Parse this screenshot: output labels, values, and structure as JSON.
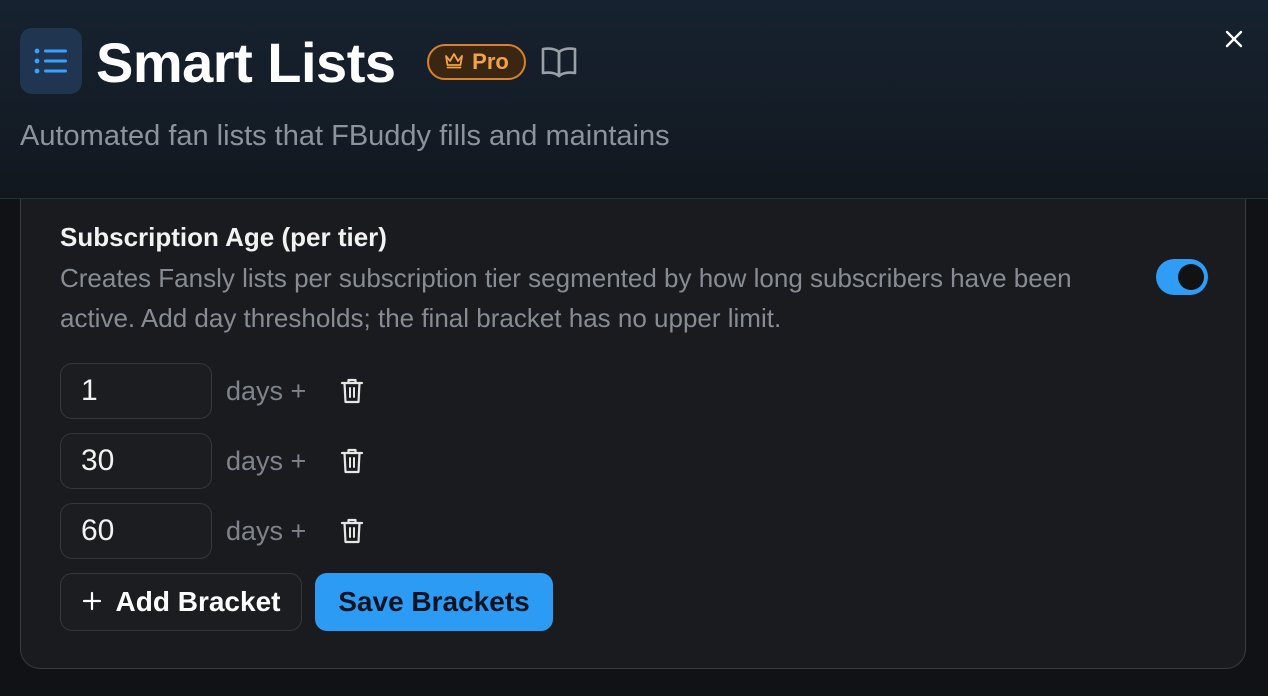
{
  "header": {
    "title": "Smart Lists",
    "badge": "Pro",
    "subtitle": "Automated fan lists that FBuddy fills and maintains",
    "icons": [
      "list-icon",
      "crown-icon",
      "book-icon",
      "close-icon"
    ]
  },
  "setting": {
    "title": "Subscription Age (per tier)",
    "description": "Creates Fansly lists per subscription tier segmented by how long subscribers have been active. Add day thresholds; the final bracket has no upper limit.",
    "enabled": true
  },
  "brackets": [
    {
      "value": "1",
      "unit": "days +"
    },
    {
      "value": "30",
      "unit": "days +"
    },
    {
      "value": "60",
      "unit": "days +"
    }
  ],
  "actions": {
    "add_label": "Add Bracket",
    "save_label": "Save Brackets"
  },
  "colors": {
    "accent": "#2b9bf4",
    "pro_badge": "#f0a347",
    "background": "#111215"
  }
}
